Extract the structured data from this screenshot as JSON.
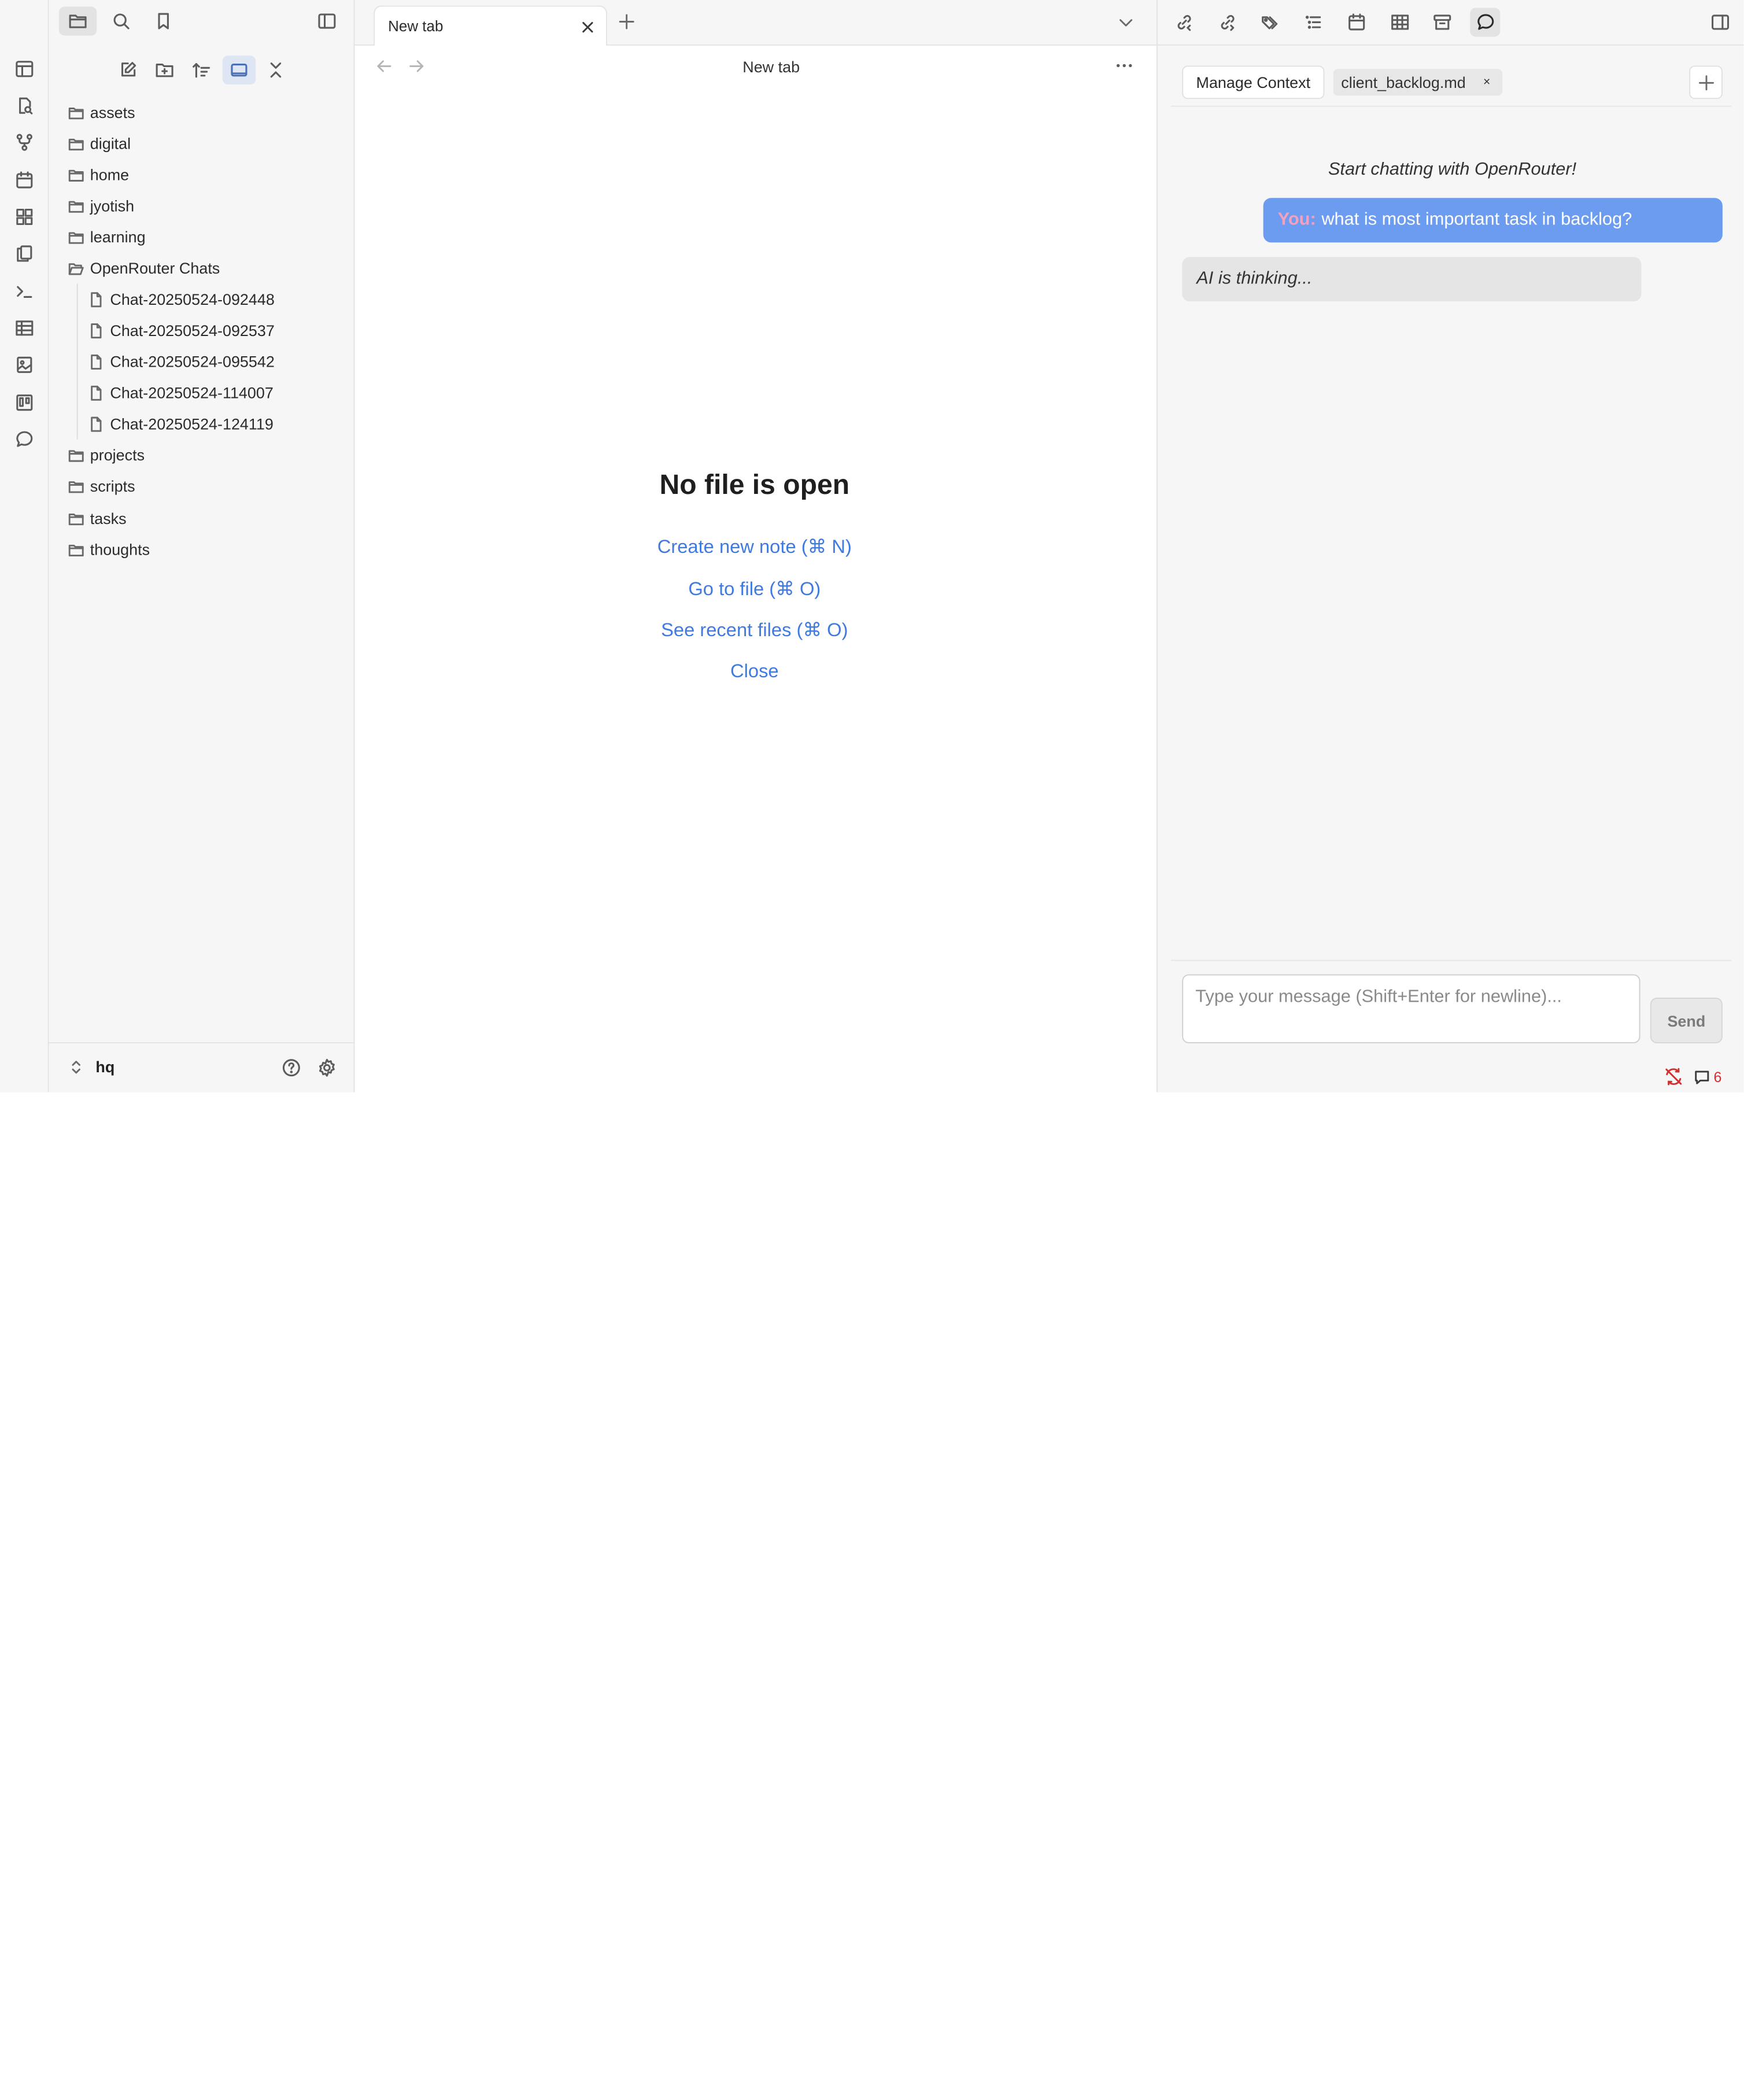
{
  "ribbon": {
    "icons": [
      "layout-dashboard-icon",
      "file-search-icon",
      "git-fork-icon",
      "calendar-icon",
      "layout-grid-icon",
      "copy-files-icon",
      "terminal-icon",
      "table-icon",
      "image-file-icon",
      "kanban-icon",
      "chat-bubble-icon"
    ]
  },
  "sidebar": {
    "top_tabs": [
      "folder-icon",
      "search-icon",
      "bookmark-icon"
    ],
    "nav_actions": [
      "new-note-icon",
      "new-folder-icon",
      "sort-icon",
      "auto-reveal-icon",
      "collapse-all-icon"
    ],
    "tree": {
      "folders_top": [
        "assets",
        "digital",
        "home",
        "jyotish",
        "learning"
      ],
      "open_folder": "OpenRouter Chats",
      "files": [
        "Chat-20250524-092448",
        "Chat-20250524-092537",
        "Chat-20250524-095542",
        "Chat-20250524-114007",
        "Chat-20250524-124119"
      ],
      "folders_bottom": [
        "projects",
        "scripts",
        "tasks",
        "thoughts"
      ]
    },
    "vault_name": "hq"
  },
  "tabs": [
    {
      "label": "New tab",
      "active": true
    }
  ],
  "main": {
    "view_title": "New tab",
    "empty_title": "No file is open",
    "actions": [
      "Create new note (⌘ N)",
      "Go to file (⌘ O)",
      "See recent files (⌘ O)",
      "Close"
    ]
  },
  "right_toolbar": {
    "icons": [
      "backlinks-icon",
      "outgoing-links-icon",
      "tags-icon",
      "outline-icon",
      "calendar-icon",
      "table-icon",
      "archive-icon",
      "chat-bubble-icon"
    ],
    "active": "chat-bubble-icon"
  },
  "chat": {
    "manage_context_label": "Manage Context",
    "context_file": "client_backlog.md",
    "context_remove": "×",
    "hint": "Start chatting with OpenRouter!",
    "messages": [
      {
        "role": "user",
        "speaker": "You:",
        "text": "what is most important task in backlog?"
      },
      {
        "role": "ai",
        "text": "AI is thinking..."
      }
    ],
    "input_placeholder": "Type your message (Shift+Enter for newline)...",
    "send_label": "Send"
  },
  "statusbar": {
    "comment_count": "6"
  },
  "colors": {
    "accent": "#3f7ae0",
    "user_bubble": "#6b9cf0",
    "user_speaker": "#f6a0bd",
    "ai_bubble": "#e5e5e5",
    "alert": "#d32f2f"
  }
}
